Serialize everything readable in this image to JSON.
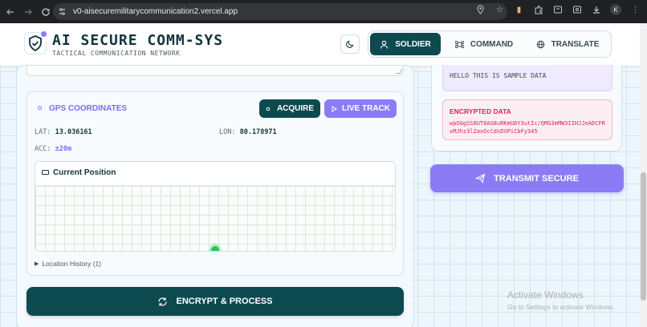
{
  "browser": {
    "url": "v0-aisecuremilitarycommunication2.vercel.app",
    "profile_initial": "K"
  },
  "header": {
    "brand": "AI SECURE COMM-SYS",
    "tagline": "TACTICAL COMMUNICATION NETWORK",
    "tabs": [
      {
        "label": "SOLDIER",
        "active": true,
        "icon": "user-icon"
      },
      {
        "label": "COMMAND",
        "active": false,
        "icon": "command-icon"
      },
      {
        "label": "TRANSLATE",
        "active": false,
        "icon": "globe-icon"
      }
    ]
  },
  "gps": {
    "title": "GPS COORDINATES",
    "acquire_label": "ACQUIRE",
    "live_track_label": "LIVE TRACK",
    "lat_label": "LAT:",
    "lat_value": "13.036161",
    "lon_label": "LON:",
    "lon_value": "80.178971",
    "acc_label": "ACC:",
    "acc_value": "±20m",
    "map_title": "Current Position",
    "history_label": "Location History (1)"
  },
  "actions": {
    "encrypt_label": "ENCRYPT & PROCESS",
    "transmit_label": "TRANSMIT SECURE"
  },
  "message": {
    "plain_text": "HELLO THIS IS SAMPLE DATA",
    "encrypted_title": "ENCRYPTED DATA",
    "encrypted_value": "wpOGgSS8UT8AG8uRKmUDY3utIc/QMG3mMW3IIHJJeADCFRxMJhz3lZaxOcCdsDVPiCbFy345"
  },
  "watermark": {
    "line1": "Activate Windows",
    "line2": "Go to Settings to activate Windows."
  },
  "colors": {
    "primary": "#0c4a50",
    "accent": "#8b7cf6",
    "danger": "#d6245f"
  }
}
